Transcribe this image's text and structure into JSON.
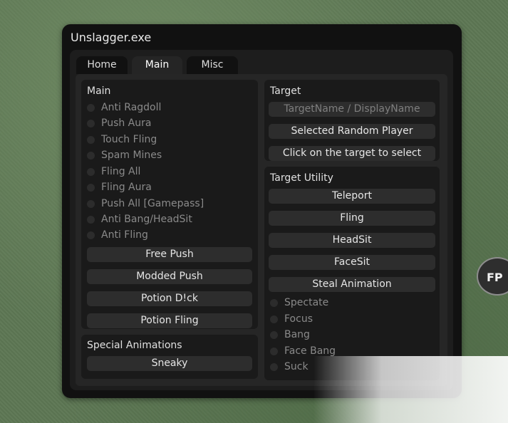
{
  "window": {
    "title": "Unslagger.exe"
  },
  "tabs": [
    {
      "label": "Home",
      "active": false
    },
    {
      "label": "Main",
      "active": true
    },
    {
      "label": "Misc",
      "active": false
    }
  ],
  "main_panel": {
    "title": "Main",
    "toggles": [
      {
        "label": "Anti Ragdoll",
        "enabled": false
      },
      {
        "label": "Push Aura",
        "enabled": false
      },
      {
        "label": "Touch Fling",
        "enabled": false
      },
      {
        "label": "Spam Mines",
        "enabled": false
      },
      {
        "label": "Fling All",
        "enabled": false
      },
      {
        "label": "Fling Aura",
        "enabled": false
      },
      {
        "label": "Push All [Gamepass]",
        "enabled": false
      },
      {
        "label": "Anti Bang/HeadSit",
        "enabled": false
      },
      {
        "label": "Anti Fling",
        "enabled": false
      }
    ],
    "buttons": [
      {
        "label": "Free Push"
      },
      {
        "label": "Modded Push"
      },
      {
        "label": "Potion D!ck"
      },
      {
        "label": "Potion Fling"
      }
    ]
  },
  "special_panel": {
    "title": "Special Animations",
    "buttons": [
      {
        "label": "Sneaky"
      }
    ]
  },
  "target_panel": {
    "title": "Target",
    "input_placeholder": "TargetName / DisplayName",
    "buttons": [
      {
        "label": "Selected Random Player"
      },
      {
        "label": "Click on the target to select"
      }
    ]
  },
  "target_utility_panel": {
    "title": "Target Utility",
    "buttons": [
      {
        "label": "Teleport"
      },
      {
        "label": "Fling"
      },
      {
        "label": "HeadSit"
      },
      {
        "label": "FaceSit"
      },
      {
        "label": "Steal Animation"
      }
    ],
    "toggles": [
      {
        "label": "Spectate",
        "enabled": false
      },
      {
        "label": "Focus",
        "enabled": false
      },
      {
        "label": "Bang",
        "enabled": false
      },
      {
        "label": "Face Bang",
        "enabled": false
      },
      {
        "label": "Suck",
        "enabled": false
      }
    ]
  },
  "fp_button": {
    "label": "FP"
  },
  "colors": {
    "window_bg": "#111111",
    "panel_bg": "#1a1a1a",
    "button_bg": "#2d2d2d",
    "text_primary": "#e6e6e6",
    "text_muted": "#8a8a8a"
  }
}
